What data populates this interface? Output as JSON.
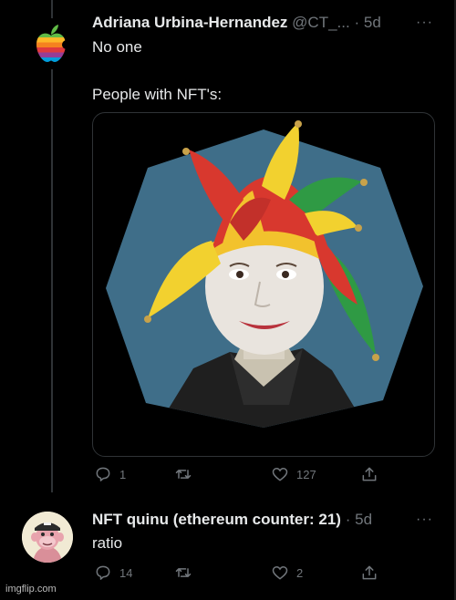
{
  "tweet1": {
    "author_name": "Adriana Urbina-Hernandez",
    "handle": "@CT_...",
    "separator": "·",
    "time": "5d",
    "more": "···",
    "line1": "No one",
    "line2": "People with NFT's:",
    "actions": {
      "replies": "1",
      "retweets": "",
      "likes": "127"
    }
  },
  "tweet2": {
    "author_name": "NFT quinu (ethereum counter: 21)",
    "separator": "·",
    "time": "5d",
    "more": "···",
    "text": "ratio",
    "actions": {
      "replies": "14",
      "retweets": "",
      "likes": "2"
    }
  },
  "watermark": "imgflip.com",
  "colors": {
    "background": "#000000",
    "text": "#e7e9ea",
    "muted": "#71767b",
    "border": "#2f3336"
  },
  "icons": [
    "apple-logo-icon",
    "reply-icon",
    "retweet-icon",
    "like-icon",
    "share-icon"
  ]
}
